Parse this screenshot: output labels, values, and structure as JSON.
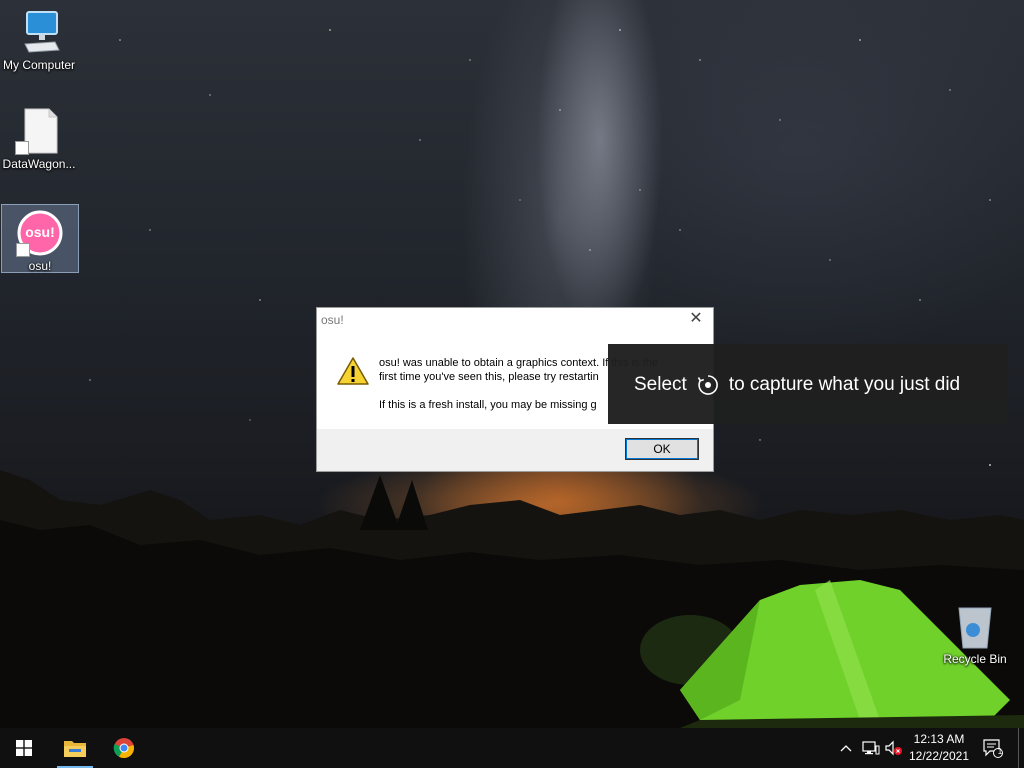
{
  "desktop": {
    "icons": [
      {
        "label": "My Computer"
      },
      {
        "label": "DataWagon..."
      },
      {
        "label": "osu!",
        "logo_text": "osu!"
      },
      {
        "label": "Recycle Bin"
      }
    ]
  },
  "dialog": {
    "title": "osu!",
    "close_glyph": "✕",
    "message_line1": "osu! was unable to obtain a graphics contex",
    "message_line1_tail": "t. If this is the",
    "message_line2": "first time you've seen this, please try restartin",
    "message_line3": "If this is a fresh install, you may be missing g",
    "ok_label": "OK",
    "icon": "warning-icon"
  },
  "toast": {
    "text_before": "Select",
    "text_after": "to capture what you just did",
    "icon": "record-capture-icon"
  },
  "taskbar": {
    "pinned": [
      "start-button",
      "file-explorer",
      "chrome"
    ],
    "tray": [
      "chevron-up-icon",
      "network-icon",
      "volume-muted-icon"
    ],
    "time": "12:13 AM",
    "date": "12/22/2021",
    "notification_count": "1"
  },
  "colors": {
    "toast_bg": "#1f1f1f",
    "taskbar_bg": "#101010",
    "osu_pink": "#ff66aa",
    "active_indicator": "#76b9ed",
    "ok_focus": "#0078d7"
  }
}
